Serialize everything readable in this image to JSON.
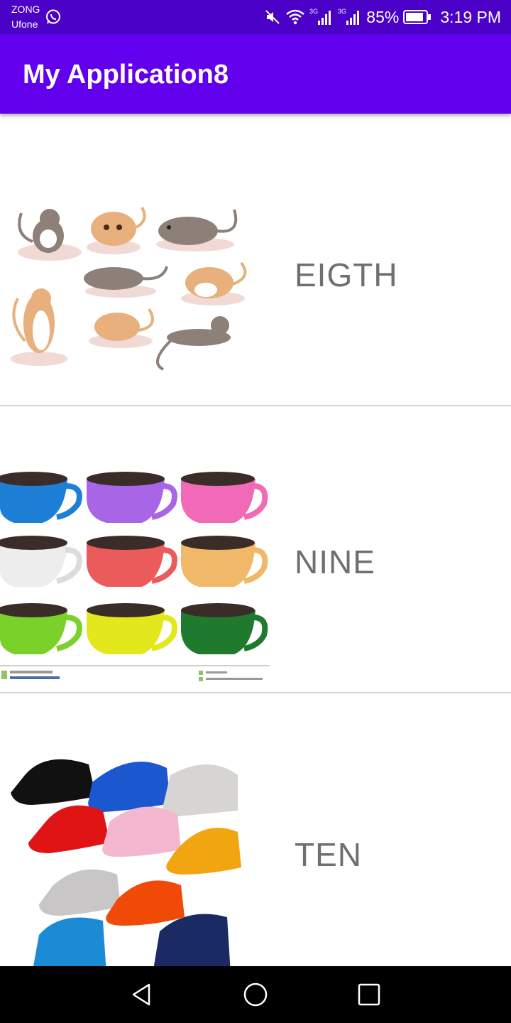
{
  "status_bar": {
    "carrier_1": "ZONG",
    "carrier_2": "Ufone",
    "icons": [
      "whatsapp-icon",
      "mute-icon",
      "wifi-icon",
      "signal-3g-icon",
      "signal-3g-icon",
      "battery-icon"
    ],
    "battery": "85%",
    "time": "3:19 PM"
  },
  "app_bar": {
    "title": "My Application8"
  },
  "list": {
    "items": [
      {
        "label": "EIGTH",
        "image": "gerbils-illustration"
      },
      {
        "label": "NINE",
        "image": "cups-illustration"
      },
      {
        "label": "TEN",
        "image": "caps-illustration"
      }
    ]
  },
  "nav_bar": {
    "icons": [
      "back-icon",
      "home-icon",
      "recents-icon"
    ]
  },
  "colors": {
    "status_bar": "#4a00c7",
    "app_bar": "#6200ee",
    "label_text": "#6f6f6f"
  }
}
